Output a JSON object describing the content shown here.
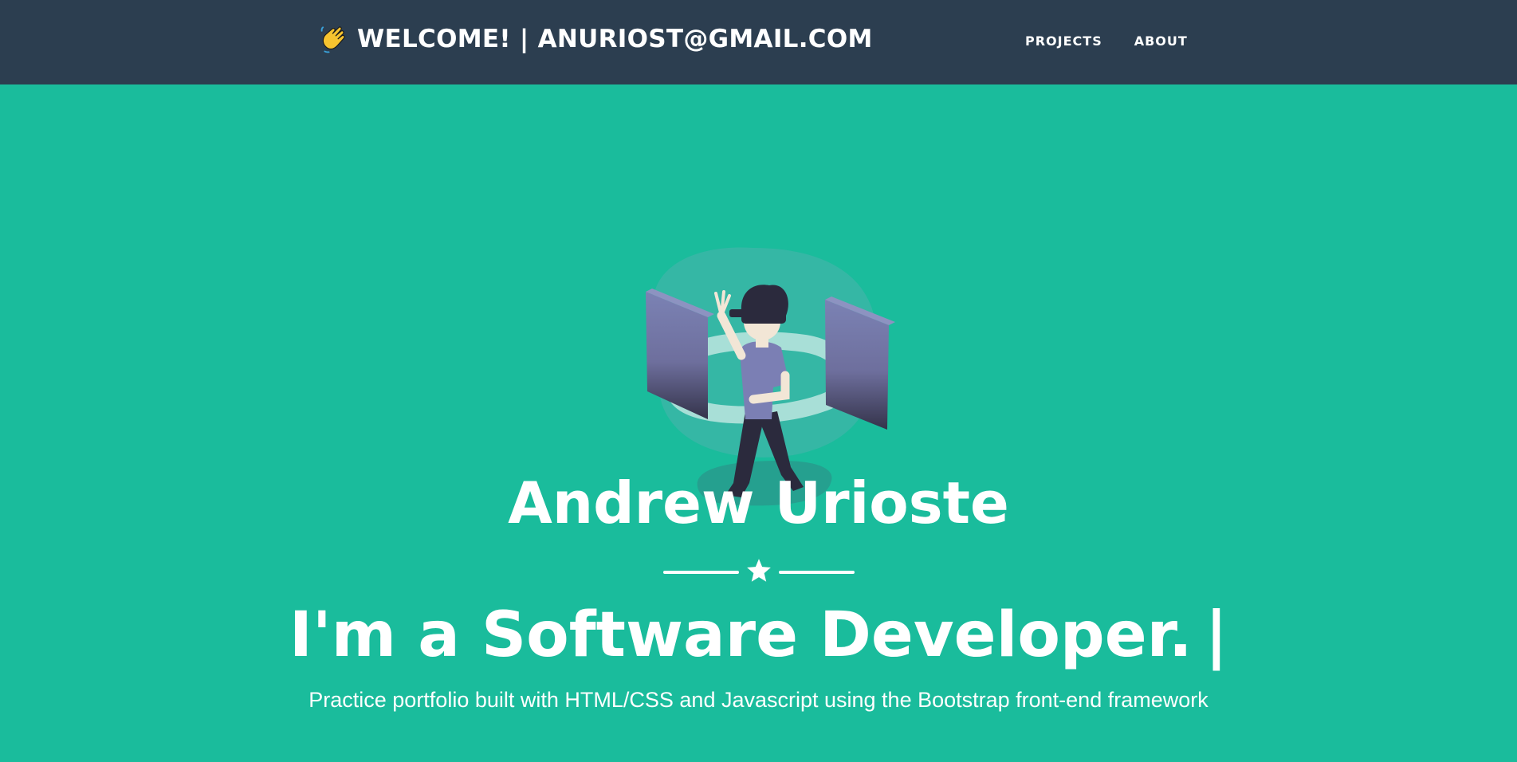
{
  "navbar": {
    "brand_text": "WELCOME! | ANURIOST@GMAIL.COM",
    "brand_icon": "waving-hand-emoji",
    "links": [
      {
        "label": "PROJECTS"
      },
      {
        "label": "ABOUT"
      }
    ],
    "background": "#2c3e50"
  },
  "masthead": {
    "background": "#1abc9c",
    "avatar_icon": "vr-developer-illustration",
    "name": "Andrew Urioste",
    "divider_icon": "star-icon",
    "tagline": "I'm a Software Developer.",
    "cursor": "|",
    "subtitle": "Practice portfolio built with HTML/CSS and Javascript using the Bootstrap front-end framework"
  }
}
